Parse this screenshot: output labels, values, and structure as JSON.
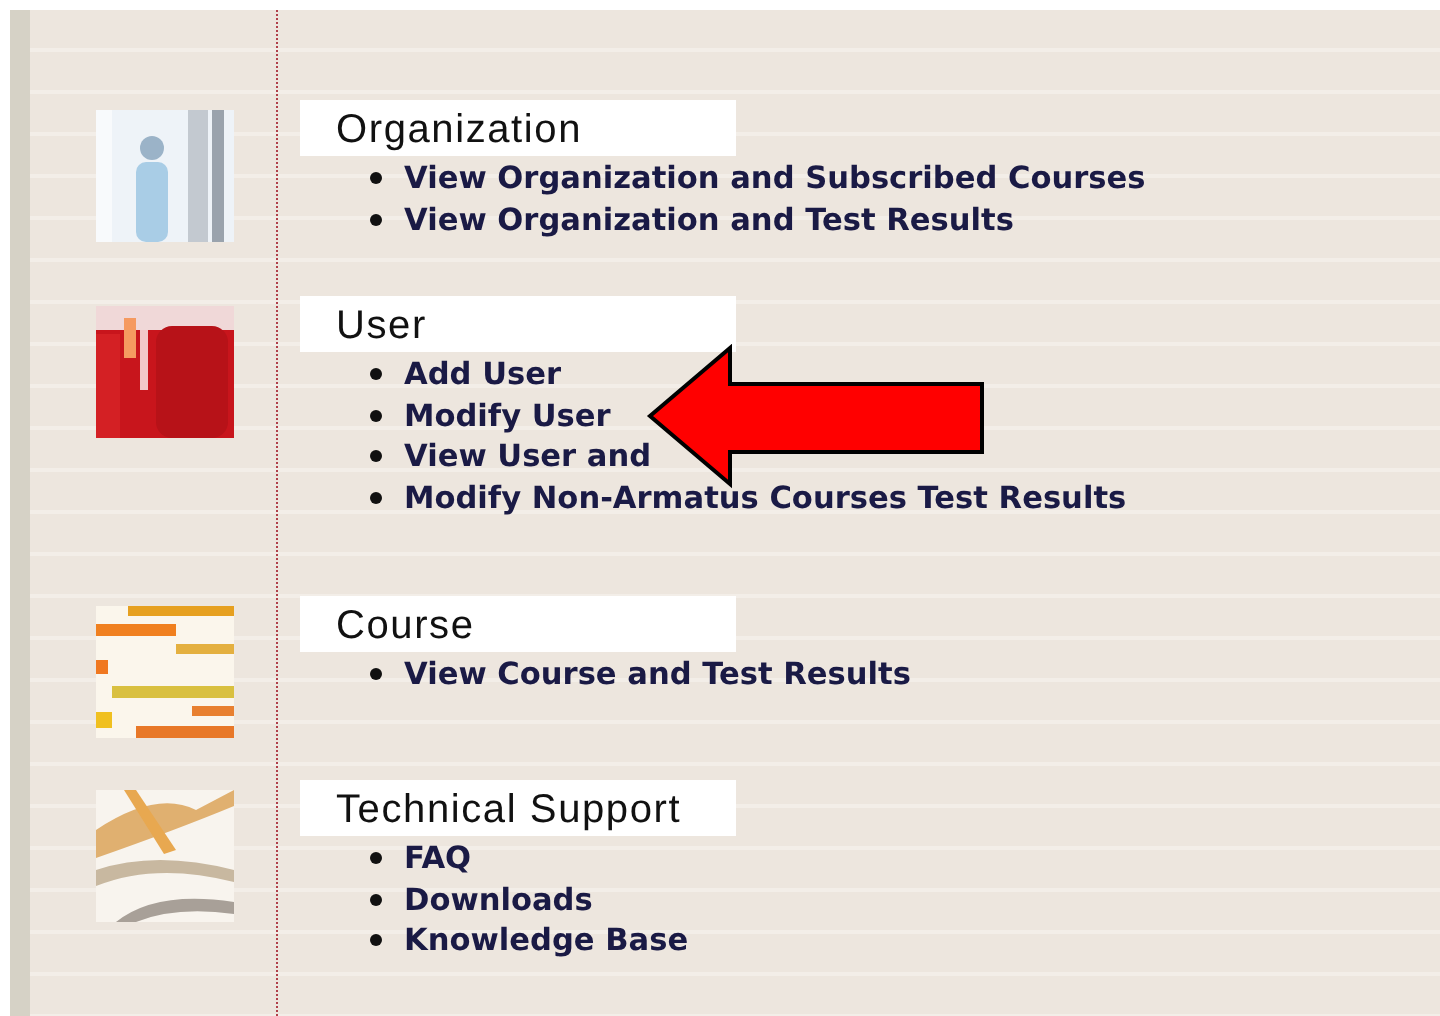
{
  "sections": [
    {
      "title": "Organization",
      "picture": {
        "kind": "picture"
      },
      "links": [
        "View Organization and Subscribed Courses",
        "View Organization and Test Results"
      ]
    },
    {
      "title": "User",
      "picture": {
        "kind": "picture"
      },
      "links": [
        "Add User",
        "Modify User",
        "View User and",
        "Modify Non-Armatus Courses Test Results"
      ]
    },
    {
      "title": "Course",
      "picture": {
        "kind": "picture"
      },
      "links": [
        "View Course and Test Results"
      ]
    },
    {
      "title": "Technical Support",
      "picture": {
        "kind": "picture"
      },
      "links": [
        "FAQ",
        "Downloads",
        "Knowledge Base"
      ]
    }
  ],
  "annotation": {
    "kind": "arrow"
  }
}
